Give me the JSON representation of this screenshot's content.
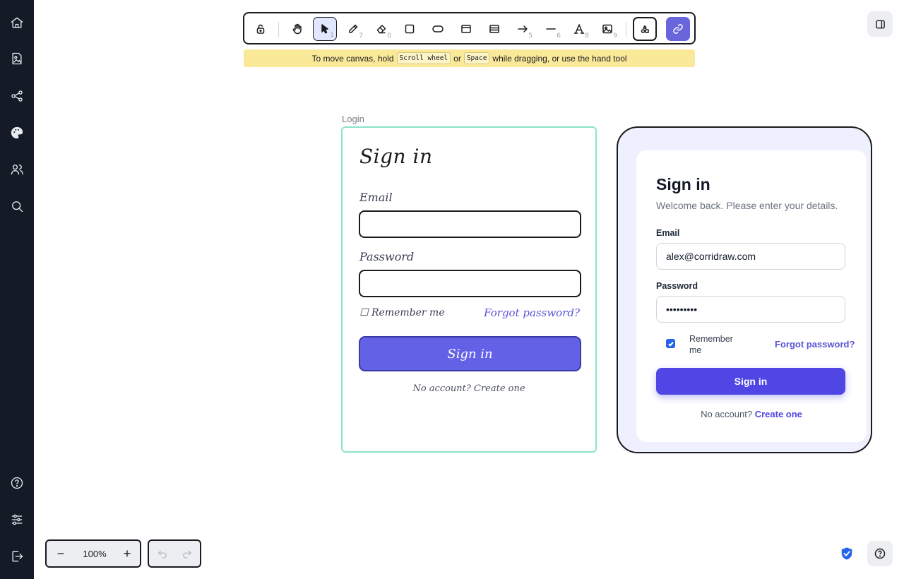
{
  "sidebar": {
    "top_items": [
      "home-icon",
      "image-file-icon",
      "share-graph-icon",
      "palette-icon",
      "users-icon",
      "search-icon"
    ],
    "bottom_items": [
      "help-circle-icon",
      "sliders-icon",
      "logout-icon"
    ]
  },
  "toolbar": {
    "tools": [
      {
        "name": "lock",
        "key": ""
      },
      {
        "name": "hand",
        "key": ""
      },
      {
        "name": "selection",
        "key": "1",
        "active": true
      },
      {
        "name": "draw",
        "key": "7"
      },
      {
        "name": "eraser",
        "key": "0"
      },
      {
        "name": "rectangle",
        "key": ""
      },
      {
        "name": "ellipse",
        "key": ""
      },
      {
        "name": "frame",
        "key": ""
      },
      {
        "name": "table",
        "key": ""
      },
      {
        "name": "arrow",
        "key": "5"
      },
      {
        "name": "line",
        "key": "6"
      },
      {
        "name": "text",
        "key": "8"
      },
      {
        "name": "image",
        "key": "9"
      },
      {
        "name": "more-shapes",
        "key": ""
      },
      {
        "name": "link",
        "key": ""
      }
    ]
  },
  "hint": {
    "pre": "To move canvas, hold",
    "key1": "Scroll wheel",
    "mid": "or",
    "key2": "Space",
    "post": "while dragging, or use the hand tool"
  },
  "frame": {
    "label": "Login"
  },
  "sketch": {
    "title": "Sign in",
    "email_label": "Email",
    "password_label": "Password",
    "remember": "☐ Remember me",
    "forgot": "Forgot password?",
    "button": "Sign in",
    "footer": "No account? Create one"
  },
  "preview": {
    "title": "Sign in",
    "subtitle": "Welcome back. Please enter your details.",
    "email_label": "Email",
    "email_value": "alex@corridraw.com",
    "password_label": "Password",
    "password_value": "•••••••••",
    "remember": "Remember me",
    "remember_checked": true,
    "forgot": "Forgot password?",
    "button": "Sign in",
    "footer_text": "No account?",
    "footer_link": "Create one"
  },
  "zoom": {
    "minus": "−",
    "value": "100%",
    "plus": "+"
  },
  "colors": {
    "sidebar": "#141b26",
    "accent": "#6965db",
    "frame_border": "#8be3c9",
    "hint_bg": "#fbe99a",
    "primary_button": "#4f46e5"
  }
}
